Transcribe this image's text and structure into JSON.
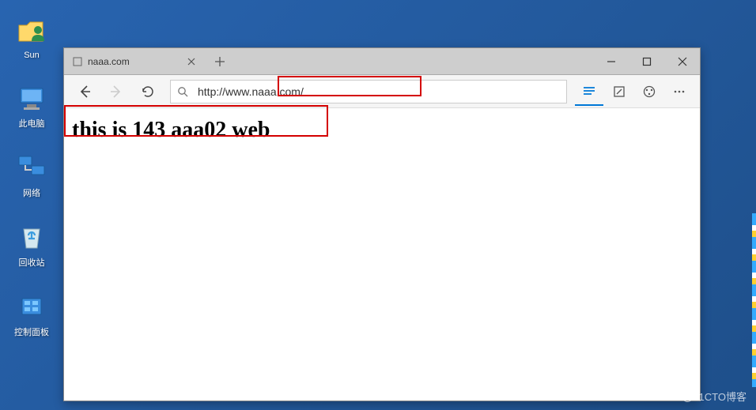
{
  "desktop": {
    "icons": [
      {
        "label": "Sun",
        "type": "folder-user"
      },
      {
        "label": "此电脑",
        "type": "pc"
      },
      {
        "label": "网络",
        "type": "network"
      },
      {
        "label": "回收站",
        "type": "recycle"
      },
      {
        "label": "控制面板",
        "type": "control-panel"
      }
    ]
  },
  "browser": {
    "tab_title": "naaa.com",
    "url": "http://www.naaa.com/",
    "page_heading": "this is 143 aaa02 web"
  },
  "watermark": "@51CTO博客"
}
